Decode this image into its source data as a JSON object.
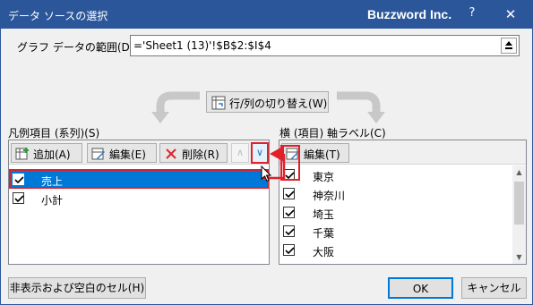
{
  "window": {
    "title": "データ ソースの選択",
    "brand": "Buzzword Inc.",
    "help_glyph": "?",
    "close_glyph": "✕"
  },
  "range": {
    "label": "グラフ データの範囲(D):",
    "value": "='Sheet1 (13)'!$B$2:$I$4"
  },
  "switch_button": {
    "label": "行/列の切り替え(W)"
  },
  "legend": {
    "label": "凡例項目 (系列)(S)",
    "add_label": "追加(A)",
    "edit_label": "編集(E)",
    "delete_label": "削除(R)",
    "up_glyph": "∧",
    "down_glyph": "∨",
    "items": [
      {
        "label": "売上",
        "checked": true,
        "selected": true
      },
      {
        "label": "小計",
        "checked": true,
        "selected": false
      }
    ]
  },
  "axis": {
    "label": "横 (項目) 軸ラベル(C)",
    "edit_label": "編集(T)",
    "items": [
      {
        "label": "東京",
        "checked": true
      },
      {
        "label": "神奈川",
        "checked": true
      },
      {
        "label": "埼玉",
        "checked": true
      },
      {
        "label": "千葉",
        "checked": true
      },
      {
        "label": "大阪",
        "checked": true
      }
    ]
  },
  "footer": {
    "hidden_cells_label": "非表示および空白のセル(H)",
    "ok_label": "OK",
    "cancel_label": "キャンセル"
  },
  "colors": {
    "titlebar": "#2b579a",
    "selection": "#0078d7",
    "highlight": "#e0202a"
  }
}
